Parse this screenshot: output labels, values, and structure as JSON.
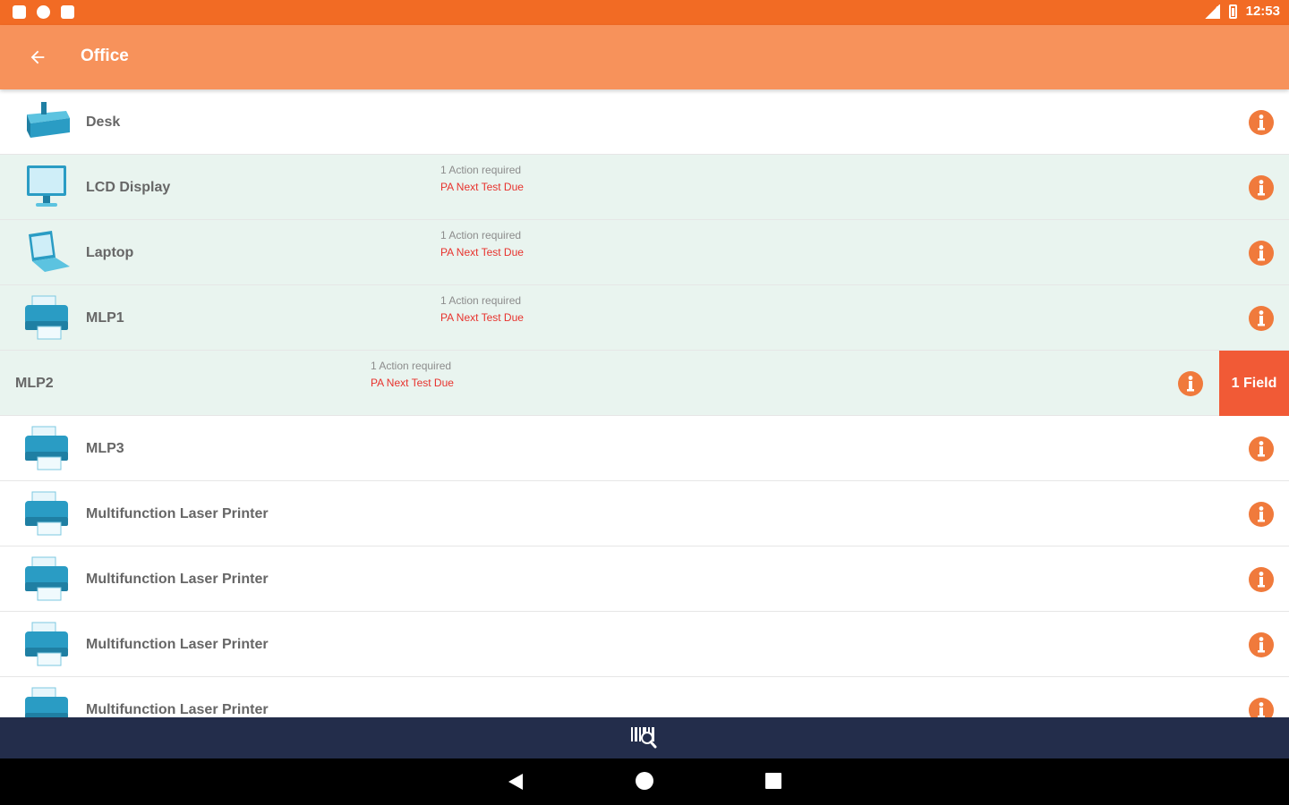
{
  "statusbar": {
    "time": "12:53"
  },
  "appbar": {
    "title": "Office"
  },
  "items": [
    {
      "name": "Desk",
      "icon": "desk-icon",
      "action_count": "",
      "action_due": ""
    },
    {
      "name": "LCD Display",
      "icon": "monitor-icon",
      "action_count": "1 Action required",
      "action_due": "PA Next Test Due"
    },
    {
      "name": "Laptop",
      "icon": "laptop-icon",
      "action_count": "1 Action required",
      "action_due": "PA Next Test Due"
    },
    {
      "name": "MLP1",
      "icon": "printer-icon",
      "action_count": "1 Action required",
      "action_due": "PA Next Test Due"
    },
    {
      "name": "MLP2",
      "icon": "printer-icon",
      "action_count": "1 Action required",
      "action_due": "PA Next Test Due",
      "swipe_action": "1 Field"
    },
    {
      "name": "MLP3",
      "icon": "printer-icon",
      "action_count": "",
      "action_due": ""
    },
    {
      "name": "Multifunction Laser Printer",
      "icon": "printer-icon",
      "action_count": "",
      "action_due": ""
    },
    {
      "name": "Multifunction Laser Printer",
      "icon": "printer-icon",
      "action_count": "",
      "action_due": ""
    },
    {
      "name": "Multifunction Laser Printer",
      "icon": "printer-icon",
      "action_count": "",
      "action_due": ""
    },
    {
      "name": "Multifunction Laser Printer",
      "icon": "printer-icon",
      "action_count": "",
      "action_due": ""
    }
  ],
  "colors": {
    "statusbar": "#f26b24",
    "appbar": "#f7925b",
    "action_row": "#e9f4ef",
    "info_icon": "#f07a3c",
    "due_text": "#e8322d",
    "field_button": "#f15a36",
    "bottombar": "#232d4b"
  }
}
